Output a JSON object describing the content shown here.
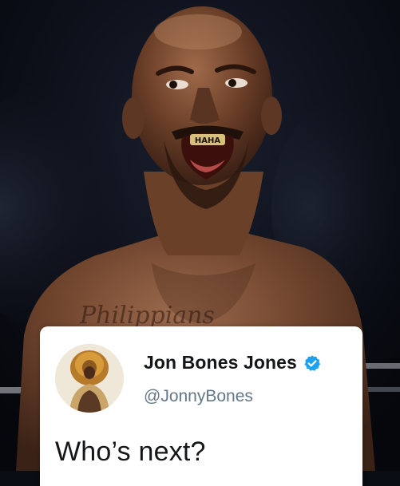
{
  "tweet": {
    "display_name": "Jon Bones Jones",
    "handle": "@JonnyBones",
    "text": "Who’s next?",
    "verified": true,
    "verified_color": "#1da1f2"
  },
  "photo": {
    "subject": "fighter",
    "grill_text": "HAHA",
    "tattoo_text": "Philippians"
  },
  "icons": {
    "verified": "verified-badge-icon",
    "avatar": "lion-avatar"
  }
}
